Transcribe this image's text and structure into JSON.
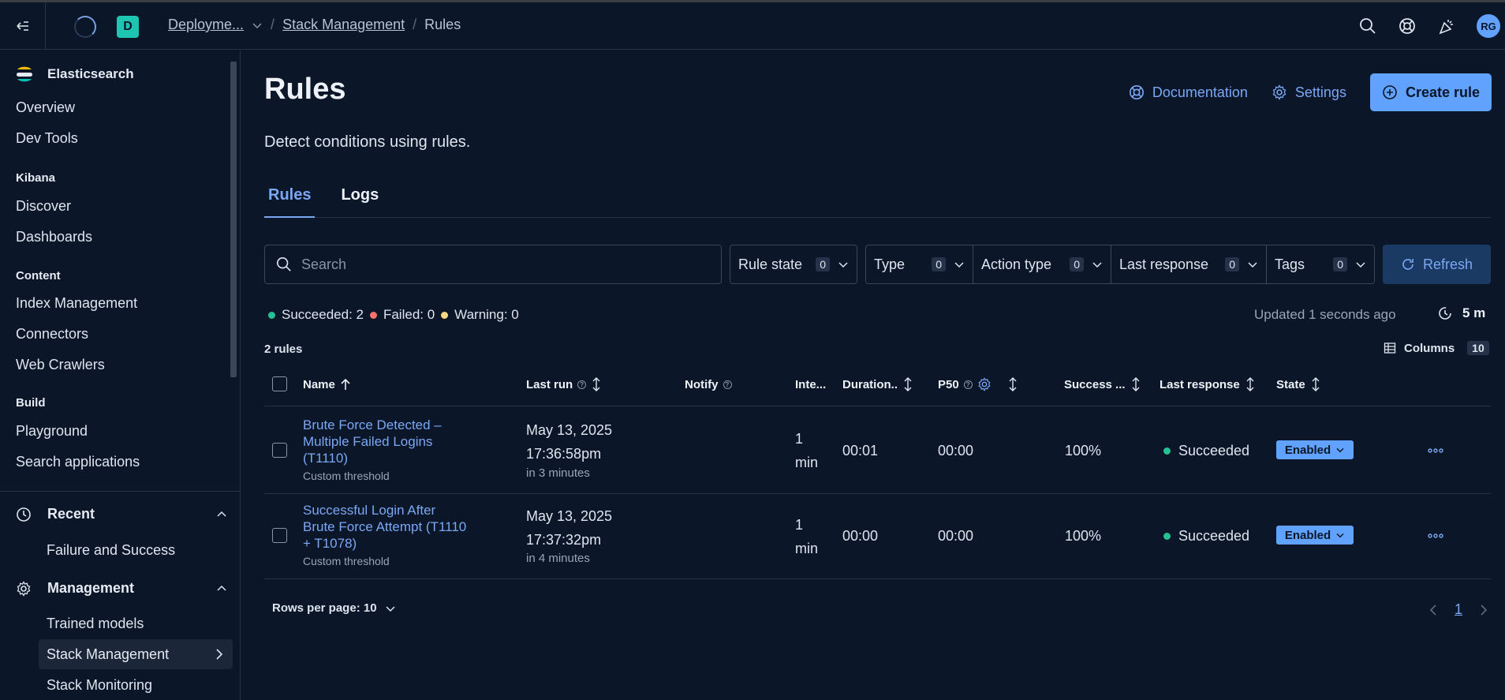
{
  "header": {
    "deployment_badge": "D",
    "breadcrumbs": [
      "Deployme...",
      "Stack Management",
      "Rules"
    ],
    "avatar": "RG"
  },
  "sidebar": {
    "title": "Elasticsearch",
    "items_top": [
      "Overview",
      "Dev Tools"
    ],
    "groups": [
      {
        "label": "Kibana",
        "items": [
          "Discover",
          "Dashboards"
        ]
      },
      {
        "label": "Content",
        "items": [
          "Index Management",
          "Connectors",
          "Web Crawlers"
        ]
      },
      {
        "label": "Build",
        "items": [
          "Playground",
          "Search applications"
        ]
      }
    ],
    "recent": {
      "label": "Recent",
      "items": [
        "Failure and Success"
      ]
    },
    "management": {
      "label": "Management",
      "items": [
        "Trained models",
        "Stack Management",
        "Stack Monitoring"
      ]
    }
  },
  "page": {
    "title": "Rules",
    "description": "Detect conditions using rules.",
    "documentation": "Documentation",
    "settings": "Settings",
    "create_rule": "Create rule",
    "tabs": [
      "Rules",
      "Logs"
    ]
  },
  "filters": {
    "search_placeholder": "Search",
    "rule_state": {
      "label": "Rule state",
      "count": "0"
    },
    "type": {
      "label": "Type",
      "count": "0"
    },
    "action_type": {
      "label": "Action type",
      "count": "0"
    },
    "last_response": {
      "label": "Last response",
      "count": "0"
    },
    "tags": {
      "label": "Tags",
      "count": "0"
    },
    "refresh": "Refresh"
  },
  "status": {
    "succeeded": "Succeeded: 2",
    "failed": "Failed: 0",
    "warning": "Warning: 0",
    "updated": "Updated 1 seconds ago",
    "interval": "5 m",
    "rule_count": "2 rules",
    "columns": "Columns",
    "columns_count": "10"
  },
  "table": {
    "headers": [
      "Name",
      "Last run",
      "Notify",
      "Inte...",
      "Duration..",
      "P50",
      "Success ...",
      "Last response",
      "State"
    ],
    "rows": [
      {
        "name": "Brute Force Detected – Multiple Failed Logins (T1110)",
        "type": "Custom threshold",
        "last_run_date": "May 13, 2025",
        "last_run_time": "17:36:58pm",
        "next_run": "in 3 minutes",
        "interval_num": "1",
        "interval_unit": "min",
        "duration": "00:01",
        "p50": "00:00",
        "success": "100%",
        "last_response": "Succeeded",
        "state": "Enabled"
      },
      {
        "name": "Successful Login After Brute Force Attempt (T1110 + T1078)",
        "type": "Custom threshold",
        "last_run_date": "May 13, 2025",
        "last_run_time": "17:37:32pm",
        "next_run": "in 4 minutes",
        "interval_num": "1",
        "interval_unit": "min",
        "duration": "00:00",
        "p50": "00:00",
        "success": "100%",
        "last_response": "Succeeded",
        "state": "Enabled"
      }
    ]
  },
  "pagination": {
    "rows_per_page": "Rows per page: 10",
    "current_page": "1"
  },
  "colors": {
    "background": "#0b1628",
    "accent": "#61a2ff",
    "link": "#7aa8f5",
    "success": "#24c292",
    "danger": "#f6726a",
    "warning": "#fcd883"
  }
}
